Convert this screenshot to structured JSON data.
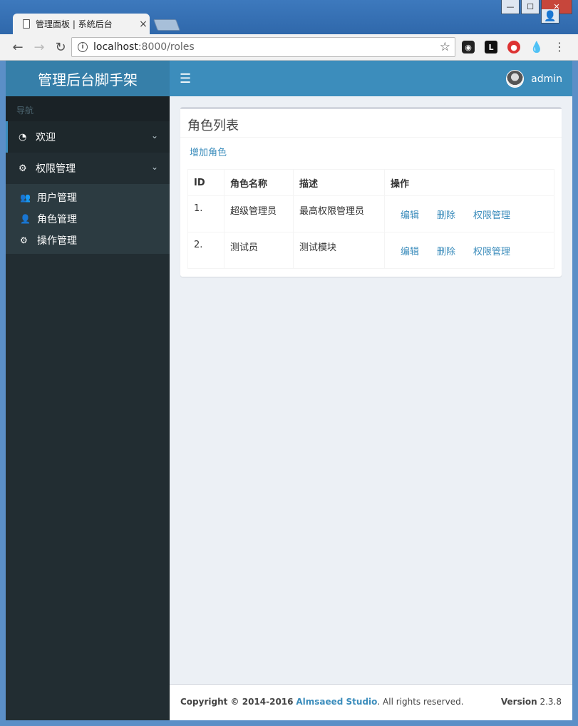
{
  "browser": {
    "tab_title": "管理面板 | 系统后台",
    "tab_close": "×",
    "url_host": "localhost",
    "url_path": ":8000/roles",
    "window_buttons": [
      "user",
      "minimize",
      "maximize",
      "close"
    ]
  },
  "header": {
    "logo": "管理后台脚手架",
    "username": "admin"
  },
  "sidebar": {
    "header": "导航",
    "items": [
      {
        "label": "欢迎",
        "icon": "dashboard-icon"
      },
      {
        "label": "权限管理",
        "icon": "cogs-icon"
      }
    ],
    "subitems": [
      {
        "label": "用户管理",
        "icon": "users-icon"
      },
      {
        "label": "角色管理",
        "icon": "user-plus-icon"
      },
      {
        "label": "操作管理",
        "icon": "cogs-icon"
      }
    ]
  },
  "main": {
    "title": "角色列表",
    "add_label": "增加角色",
    "columns": [
      "ID",
      "角色名称",
      "描述",
      "操作"
    ],
    "rows": [
      {
        "id": "1.",
        "name": "超级管理员",
        "desc": "最高权限管理员"
      },
      {
        "id": "2.",
        "name": "测试员",
        "desc": "测试模块"
      }
    ],
    "ops": [
      "编辑",
      "删除",
      "权限管理"
    ]
  },
  "footer": {
    "copyright": "Copyright © 2014-2016",
    "studio": "Almsaeed Studio",
    "rights": ". All rights reserved.",
    "version_label": "Version",
    "version": "2.3.8"
  },
  "colors": {
    "brand": "#3c8dbc",
    "logo_bg": "#367fa9",
    "sidebar_bg": "#222d32"
  }
}
